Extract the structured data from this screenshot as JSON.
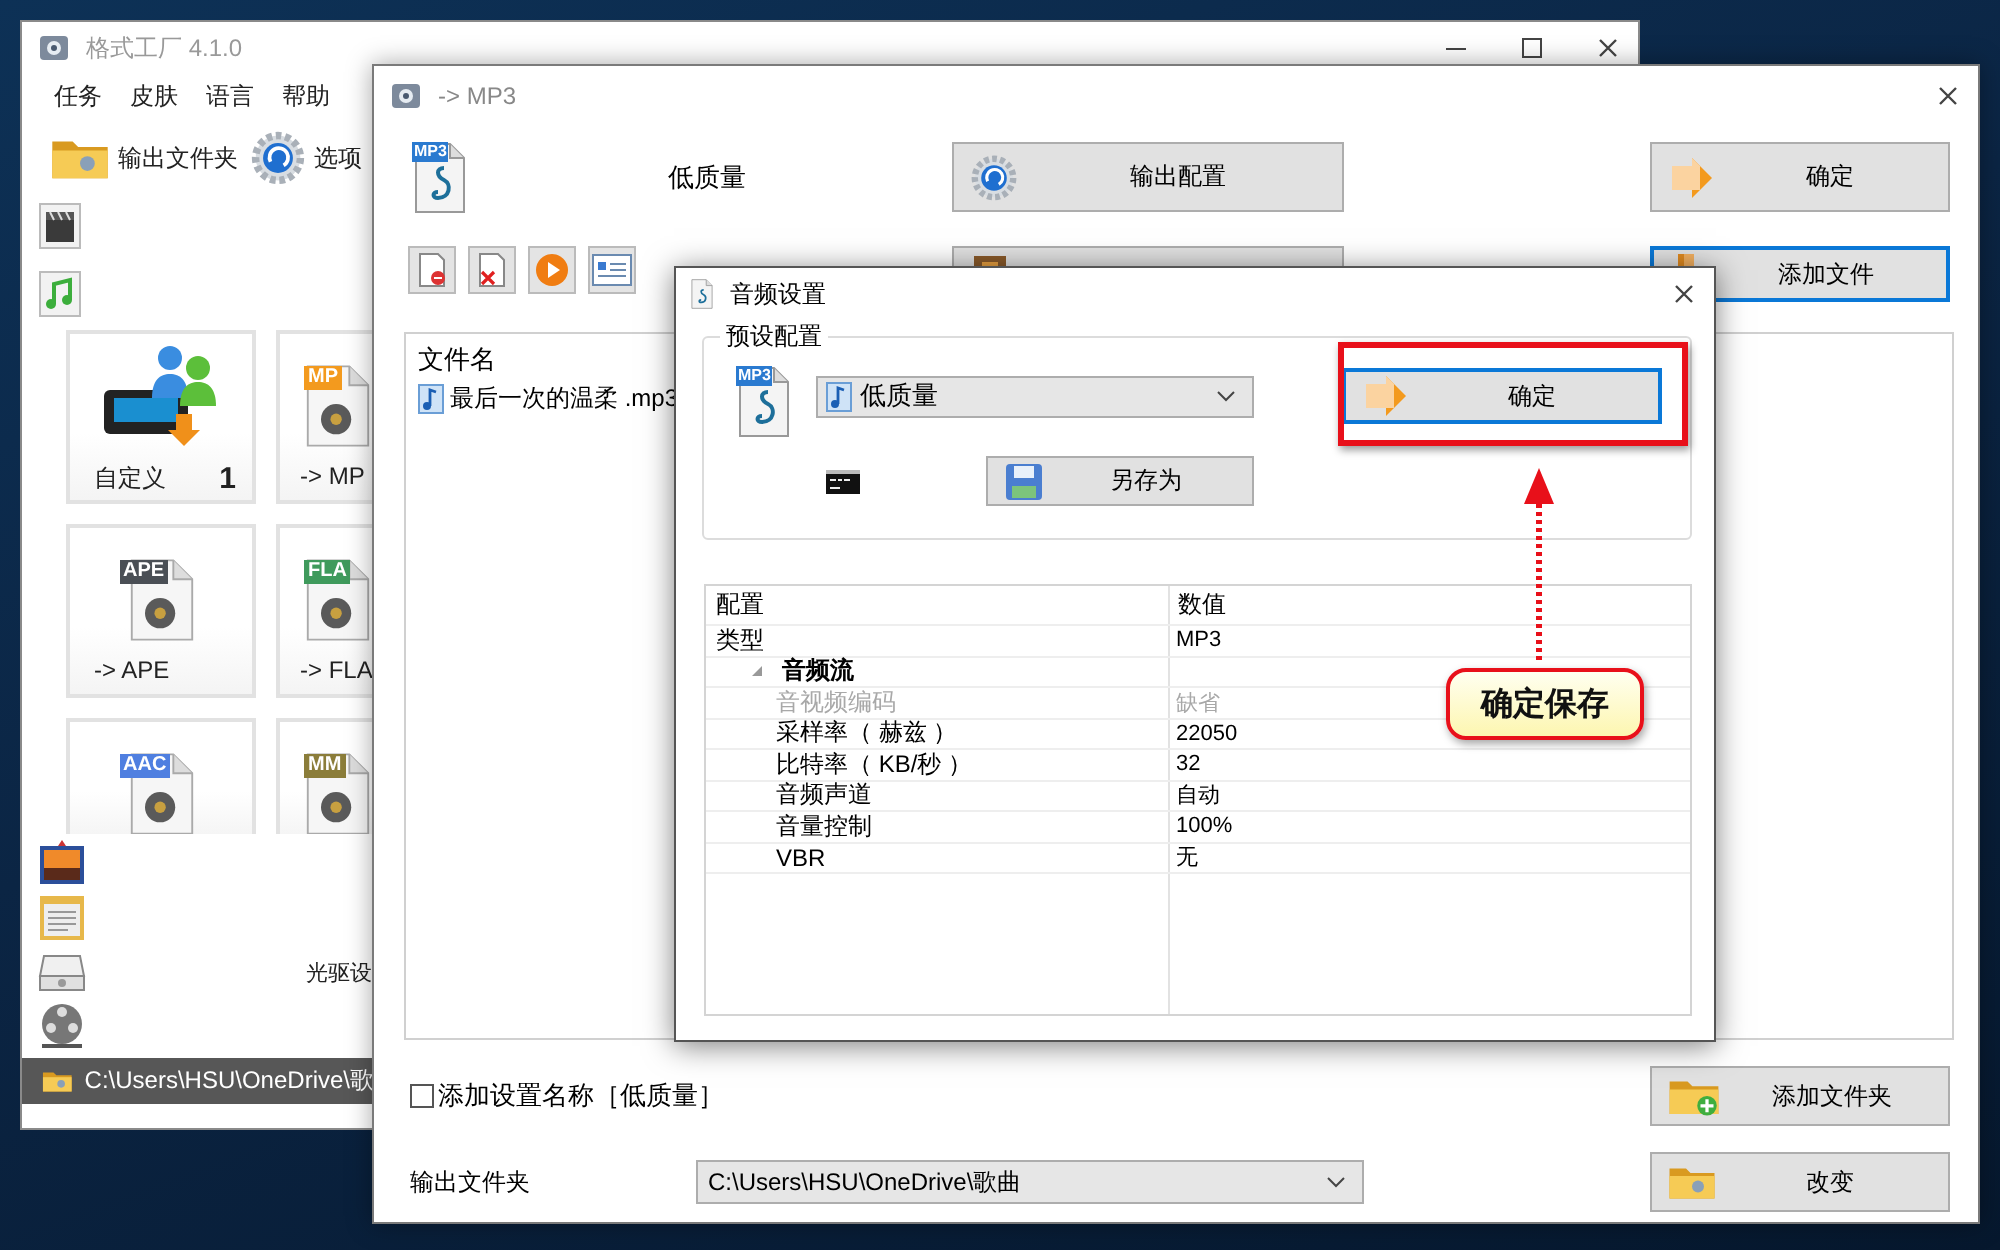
{
  "main_window": {
    "title": "格式工厂 4.1.0",
    "menu": [
      {
        "label": "任务"
      },
      {
        "label": "皮肤"
      },
      {
        "label": "语言"
      },
      {
        "label": "帮助"
      }
    ],
    "toolbar": [
      {
        "kind": "folder",
        "label": "输出文件夹"
      },
      {
        "kind": "options",
        "label": "选项"
      }
    ],
    "categories_top": [
      {
        "kind": "video"
      },
      {
        "kind": "audio"
      }
    ],
    "tiles": [
      {
        "kind": "custom",
        "label": "自定义",
        "count": "1"
      },
      {
        "kind": "file",
        "label": "-> MP",
        "badge": "MP",
        "color": "#f39a1e"
      },
      {
        "kind": "file",
        "label": "-> APE",
        "badge": "APE",
        "color": "#4a4f55"
      },
      {
        "kind": "file",
        "label": "-> FLA",
        "badge": "FLA",
        "color": "#3f9a5c"
      },
      {
        "kind": "file",
        "badge": "AAC",
        "color": "#4f7fe0"
      },
      {
        "kind": "file",
        "badge": "MM",
        "color": "#8b7d3a"
      }
    ],
    "categories_bottom": [
      {
        "kind": "picture"
      },
      {
        "kind": "document"
      },
      {
        "kind": "disc",
        "label": "光驱设"
      },
      {
        "kind": "utility"
      }
    ],
    "status_path": "C:\\Users\\HSU\\OneDrive\\歌"
  },
  "convert_window": {
    "title": "-> MP3",
    "format_badge": "MP3",
    "preset": "低质量",
    "buttons": [
      {
        "kind": "settings",
        "label": "输出配置",
        "focused": false
      },
      {
        "kind": "ok",
        "label": "确定",
        "focused": false
      },
      {
        "kind": "clip",
        "focused": false
      },
      {
        "kind": "add_file",
        "label": "添加文件",
        "focused": true
      }
    ],
    "file_tools": [
      {
        "kind": "remove"
      },
      {
        "kind": "delete"
      },
      {
        "kind": "play"
      },
      {
        "kind": "details"
      }
    ],
    "file_list": {
      "column": "文件名",
      "files": [
        {
          "name": "最后一次的温柔 .mp3"
        }
      ]
    },
    "add_name": {
      "label": "添加设置名称［低质量］",
      "checked": false
    },
    "add_folder_button": {
      "label": "添加文件夹",
      "focused": false
    },
    "output_folder": {
      "label": "输出文件夹",
      "value": "C:\\Users\\HSU\\OneDrive\\歌曲"
    },
    "change_button": {
      "label": "改变",
      "focused": false
    }
  },
  "audio_dialog": {
    "title": "音频设置",
    "group": "预设配置",
    "format_badge": "MP3",
    "preset": "低质量",
    "ok_button": {
      "label": "确定",
      "focused": true
    },
    "save_as_button": {
      "label": "另存为",
      "focused": false
    },
    "properties": {
      "columns": [
        "配置",
        "数值"
      ],
      "rows": [
        {
          "name": "类型",
          "value": "MP3",
          "disabled": false
        },
        {
          "kind": "group",
          "name": "音频流",
          "expanded": true,
          "children": [
            {
              "name": "音视频编码",
              "value": "缺省",
              "disabled": true
            },
            {
              "name": "采样率（ 赫兹 ）",
              "value": "22050",
              "disabled": false
            },
            {
              "name": "比特率（ KB/秒 ）",
              "value": "32",
              "disabled": false
            },
            {
              "name": "音频声道",
              "value": "自动",
              "disabled": false
            },
            {
              "name": "音量控制",
              "value": "100%",
              "disabled": false
            },
            {
              "name": "VBR",
              "value": "无",
              "disabled": false
            }
          ]
        }
      ]
    }
  },
  "annotation": {
    "callout": "确定保存"
  }
}
